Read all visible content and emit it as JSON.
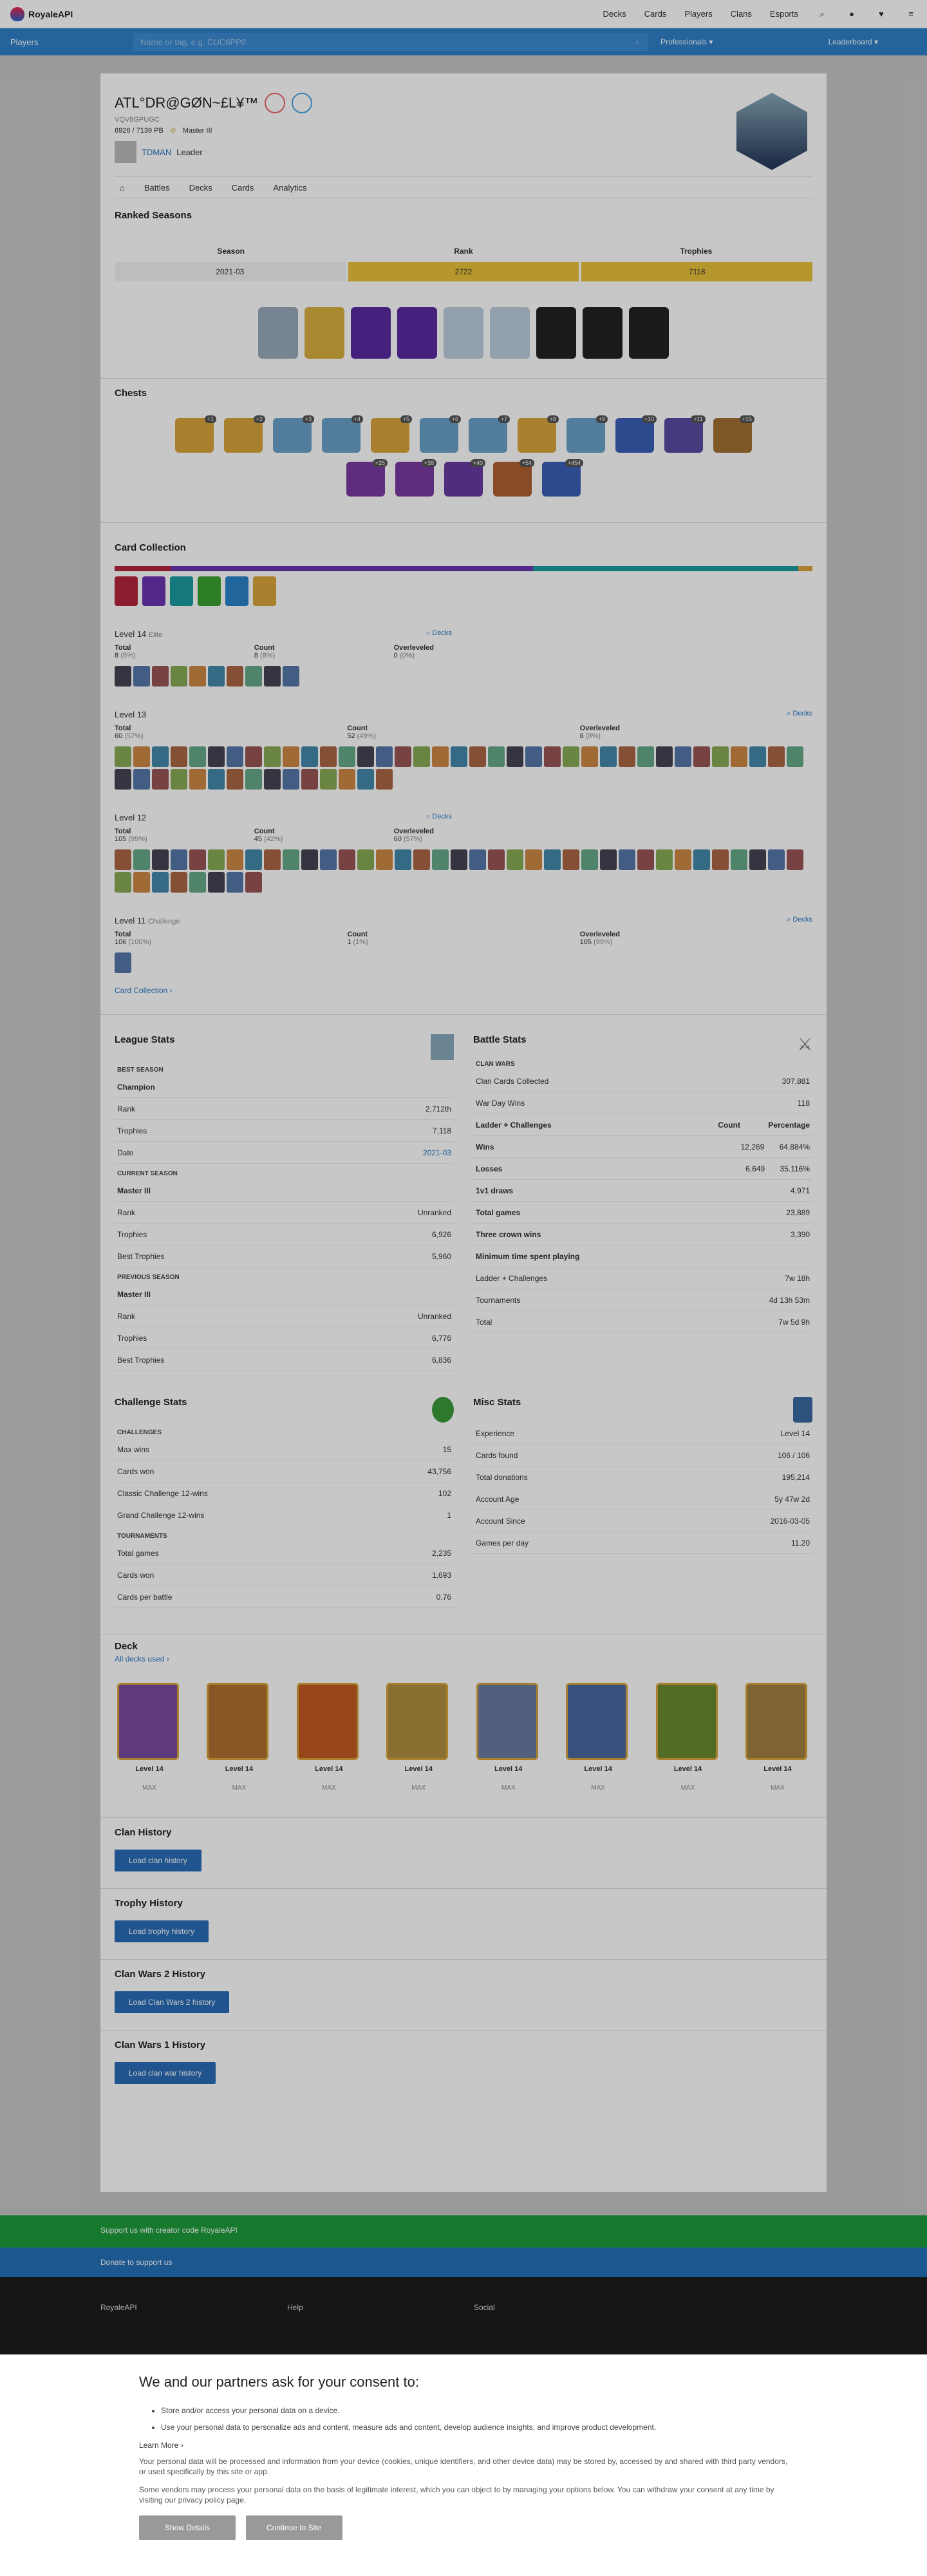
{
  "nav": {
    "brand": "RoyaleAPI",
    "links": [
      "Decks",
      "Cards",
      "Players",
      "Clans",
      "Esports"
    ]
  },
  "search": {
    "left": "Players",
    "placeholder": "Name or tag, e.g. CUC6PP0",
    "filter": "Professionals",
    "right": "Leaderboard"
  },
  "player": {
    "name": "ATL°DR@GØN~£L¥™",
    "tag": "VQV8GPUGC",
    "trophies": "6926 / 7139 PB",
    "league": "Master III",
    "clan": "TDMAN",
    "role": "Leader"
  },
  "tabs": [
    "Battles",
    "Decks",
    "Cards",
    "Analytics"
  ],
  "ranked": {
    "title": "Ranked Seasons",
    "headers": [
      "Season",
      "Rank",
      "Trophies"
    ],
    "row": [
      "2021-03",
      "2722",
      "7118"
    ]
  },
  "chests": {
    "title": "Chests",
    "counts": [
      "+1",
      "+2",
      "+3",
      "+4",
      "+5",
      "+6",
      "+7",
      "+8",
      "+9",
      "+10",
      "+11",
      "+15",
      "+25",
      "+38",
      "+40",
      "+54",
      "+454"
    ]
  },
  "collection": {
    "title": "Card Collection",
    "levels": [
      {
        "name": "Level 14",
        "note": "Elite",
        "total": "8",
        "total_pct": "(8%)",
        "count": "8",
        "count_pct": "(8%)",
        "over": "0",
        "over_pct": "(0%)"
      },
      {
        "name": "Level 13",
        "note": "",
        "total": "60",
        "total_pct": "(57%)",
        "count": "52",
        "count_pct": "(49%)",
        "over": "8",
        "over_pct": "(8%)"
      },
      {
        "name": "Level 12",
        "note": "",
        "total": "105",
        "total_pct": "(99%)",
        "count": "45",
        "count_pct": "(42%)",
        "over": "60",
        "over_pct": "(57%)"
      },
      {
        "name": "Level 11",
        "note": "Challenge",
        "total": "106",
        "total_pct": "(100%)",
        "count": "1",
        "count_pct": "(1%)",
        "over": "105",
        "over_pct": "(99%)"
      }
    ],
    "link": "Card Collection"
  },
  "league": {
    "title": "League Stats",
    "best": "Champion",
    "rank": "2,712th",
    "trophies": "7,118",
    "date": "2021-03",
    "current": "Master III",
    "cur_rank": "Unranked",
    "cur_trophies": "6,926",
    "cur_best": "5,960",
    "previous": "Master III",
    "prev_rank": "Unranked",
    "prev_trophies": "6,776",
    "prev_best": "6,836"
  },
  "battle": {
    "title": "Battle Stats",
    "cards_collected": "307,881",
    "war_day_wins": "118",
    "wins": "12,269",
    "wins_pct": "64.884%",
    "losses": "6,649",
    "losses_pct": "35.116%",
    "draws": "4,971",
    "total_games": "23,889",
    "three_crown": "3,390",
    "ladder_time": "7w 18h",
    "tourn_time": "4d 13h 53m",
    "total_time": "7w 5d 9h"
  },
  "challenge": {
    "title": "Challenge Stats",
    "max_wins": "15",
    "cards_won": "43,756",
    "classic": "102",
    "grand": "1",
    "tour_games": "2,235",
    "tour_cards": "1,693",
    "cards_per_battle": "0.76"
  },
  "misc": {
    "title": "Misc Stats",
    "experience": "Level 14",
    "cards_found": "106 / 106",
    "donations": "195,214",
    "age": "5y 47w 2d",
    "since": "2016-03-05",
    "games_per_day": "11.20"
  },
  "deck": {
    "title": "Deck",
    "link": "All decks used",
    "cards": [
      "Level 14",
      "Level 14",
      "Level 14",
      "Level 14",
      "Level 14",
      "Level 14",
      "Level 14",
      "Level 14"
    ]
  },
  "history": [
    {
      "title": "Clan History",
      "btn": "Load clan history"
    },
    {
      "title": "Trophy History",
      "btn": "Load trophy history"
    },
    {
      "title": "Clan Wars 2 History",
      "btn": "Load Clan Wars 2 history"
    },
    {
      "title": "Clan Wars 1 History",
      "btn": "Load clan war history"
    }
  ],
  "support": {
    "green": "Support us with creator code RoyaleAPI",
    "blue": "Donate to support us"
  },
  "footer": {
    "cols": [
      "RoyaleAPI",
      "Help",
      "Social"
    ]
  },
  "consent": {
    "title": "We and our partners ask for your consent to:",
    "items": [
      "Store and/or access your personal data on a device.",
      "Use your personal data to personalize ads and content, measure ads and content, develop audience insights, and improve product development."
    ],
    "learn": "Learn More",
    "p1": "Your personal data will be processed and information from your device (cookies, unique identifiers, and other device data) may be stored by, accessed by and shared with third party vendors, or used specifically by this site or app.",
    "p2": "Some vendors may process your personal data on the basis of legitimate interest, which you can object to by managing your options below. You can withdraw your consent at any time by visiting our privacy policy page.",
    "btn1": "Show Details",
    "btn2": "Continue to Site"
  }
}
